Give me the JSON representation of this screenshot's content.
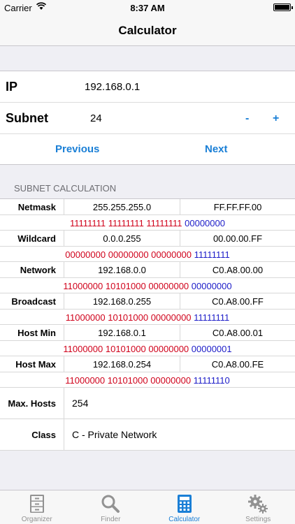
{
  "status_bar": {
    "carrier": "Carrier",
    "time": "8:37 AM"
  },
  "nav": {
    "title": "Calculator"
  },
  "inputs": {
    "ip_label": "IP",
    "ip_value": "192.168.0.1",
    "subnet_label": "Subnet",
    "subnet_value": "24",
    "minus": "-",
    "plus": "+",
    "previous": "Previous",
    "next": "Next"
  },
  "section_header": "SUBNET CALCULATION",
  "rows": [
    {
      "name": "Netmask",
      "dec": "255.255.255.0",
      "hex": "FF.FF.FF.00",
      "bin_red": "11111111 11111111 11111111",
      "bin_blue": "00000000"
    },
    {
      "name": "Wildcard",
      "dec": "0.0.0.255",
      "hex": "00.00.00.FF",
      "bin_red": "00000000 00000000 00000000",
      "bin_blue": "11111111"
    },
    {
      "name": "Network",
      "dec": "192.168.0.0",
      "hex": "C0.A8.00.00",
      "bin_red": "11000000 10101000 00000000",
      "bin_blue": "00000000"
    },
    {
      "name": "Broadcast",
      "dec": "192.168.0.255",
      "hex": "C0.A8.00.FF",
      "bin_red": "11000000 10101000 00000000",
      "bin_blue": "11111111"
    },
    {
      "name": "Host Min",
      "dec": "192.168.0.1",
      "hex": "C0.A8.00.01",
      "bin_red": "11000000 10101000 00000000",
      "bin_blue": "00000001"
    },
    {
      "name": "Host Max",
      "dec": "192.168.0.254",
      "hex": "C0.A8.00.FE",
      "bin_red": "11000000 10101000 00000000",
      "bin_blue": "11111110"
    }
  ],
  "info": {
    "max_hosts_label": "Max. Hosts",
    "max_hosts_value": "254",
    "class_label": "Class",
    "class_value": "C - Private Network"
  },
  "tabs": [
    {
      "label": "Organizer",
      "icon": "cabinet-icon",
      "active": false
    },
    {
      "label": "Finder",
      "icon": "magnifier-icon",
      "active": false
    },
    {
      "label": "Calculator",
      "icon": "calculator-icon",
      "active": true
    },
    {
      "label": "Settings",
      "icon": "gears-icon",
      "active": false
    }
  ],
  "colors": {
    "accent": "#1a7fd6",
    "binary_network": "#d0021b",
    "binary_host": "#1c1cc8"
  }
}
